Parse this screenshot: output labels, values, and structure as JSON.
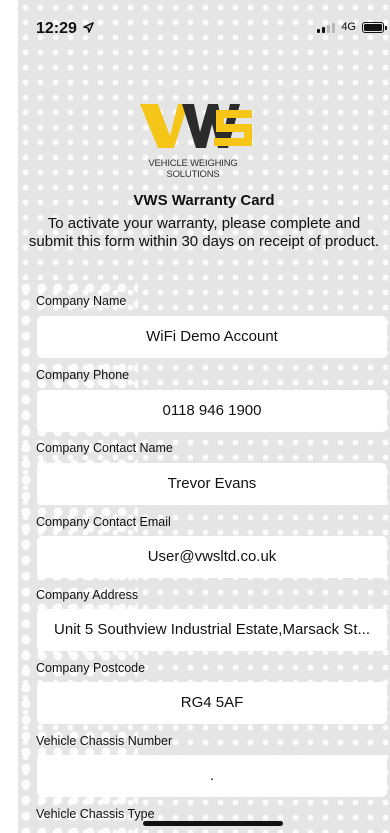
{
  "status_bar": {
    "time": "12:29",
    "network": "4G"
  },
  "logo": {
    "text": "VWS",
    "caption": "VEHICLE WEIGHING SOLUTIONS",
    "colors": {
      "yellow": "#f5c518",
      "dark": "#2b2b2b"
    }
  },
  "form": {
    "title": "VWS Warranty Card",
    "intro": "To activate your warranty, please complete and submit this form within 30 days on receipt of product.",
    "fields": [
      {
        "label": "Company Name",
        "value": "WiFi Demo Account"
      },
      {
        "label": "Company Phone",
        "value": "0118 946 1900"
      },
      {
        "label": "Company Contact Name",
        "value": "Trevor Evans"
      },
      {
        "label": "Company Contact Email",
        "value": "User@vwsltd.co.uk"
      },
      {
        "label": "Company Address",
        "value": "Unit 5 Southview Industrial Estate,Marsack St..."
      },
      {
        "label": "Company Postcode",
        "value": "RG4 5AF"
      },
      {
        "label": "Vehicle Chassis Number",
        "value": "."
      },
      {
        "label": "Vehicle Chassis Type",
        "value": ""
      }
    ]
  },
  "colors": {
    "background": "#e5e5e5",
    "input_background": "#ffffff",
    "text": "#111111"
  }
}
